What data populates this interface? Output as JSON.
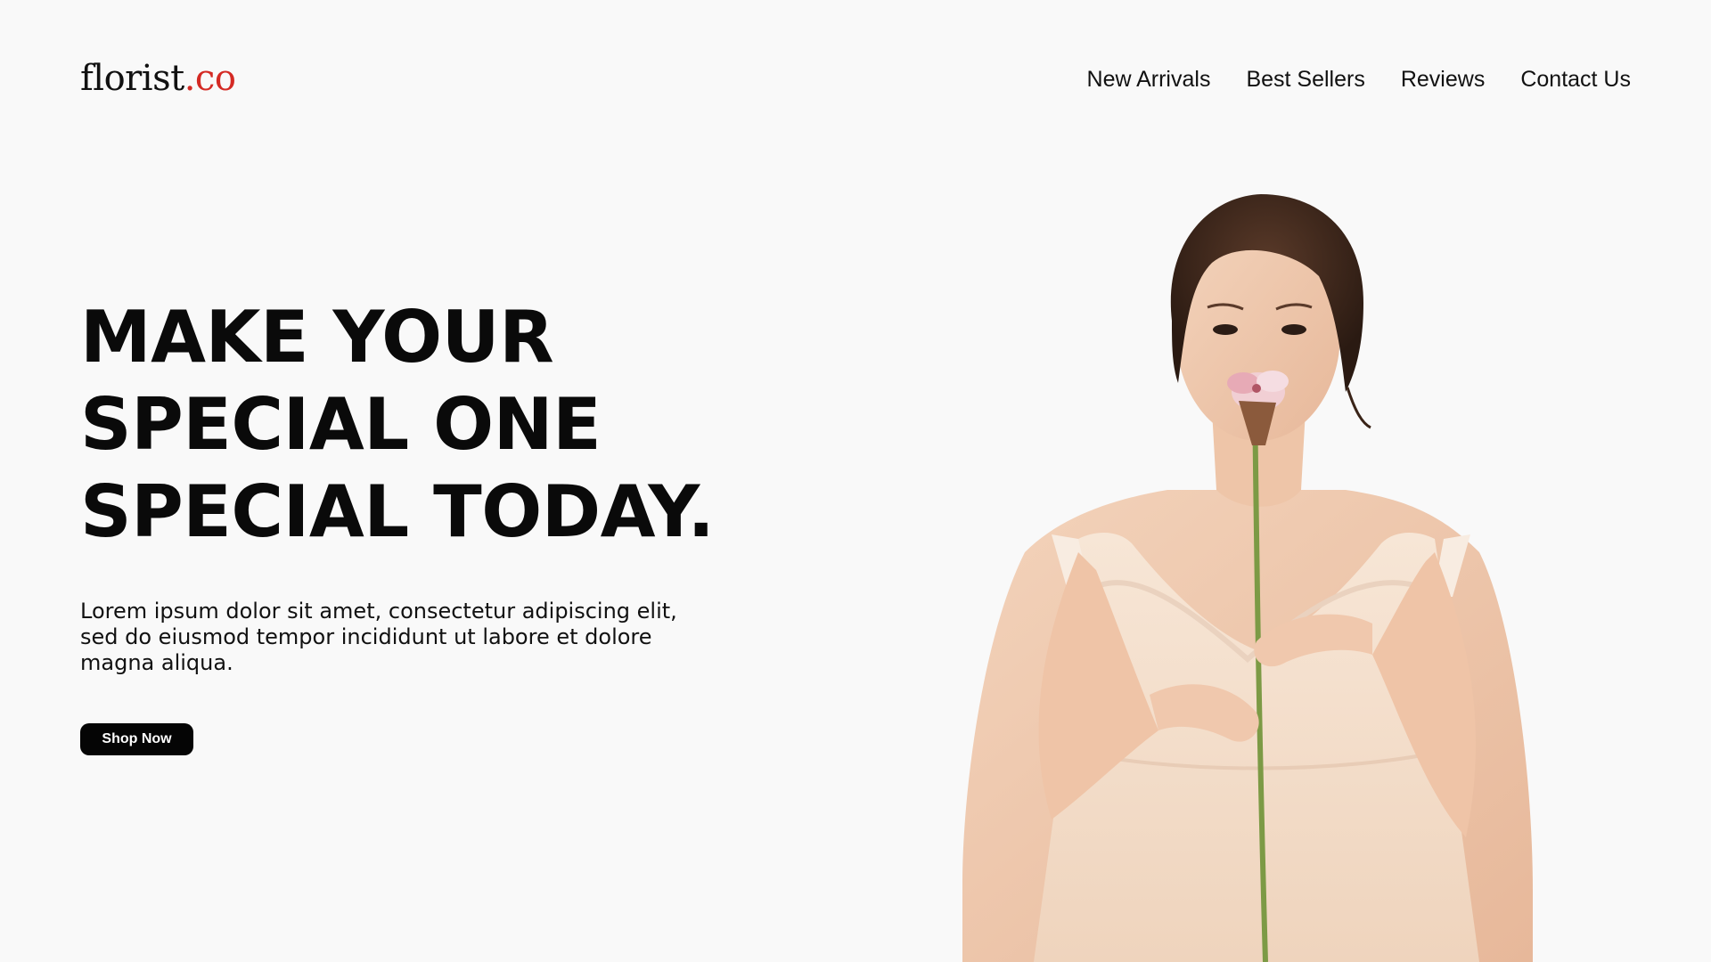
{
  "brand": {
    "name_main": "florist",
    "name_accent": ".co",
    "accent_color": "#d42a24"
  },
  "nav": {
    "items": [
      "New Arrivals",
      "Best Sellers",
      "Reviews",
      "Contact Us"
    ]
  },
  "hero": {
    "headline_lines": [
      "MAKE YOUR",
      "SPECIAL ONE",
      "SPECIAL TODAY."
    ],
    "description": "Lorem ipsum dolor sit amet, consectetur adipiscing elit, sed do eiusmod tempor incididunt ut labore et dolore magna aliqua.",
    "cta_label": "Shop Now"
  }
}
